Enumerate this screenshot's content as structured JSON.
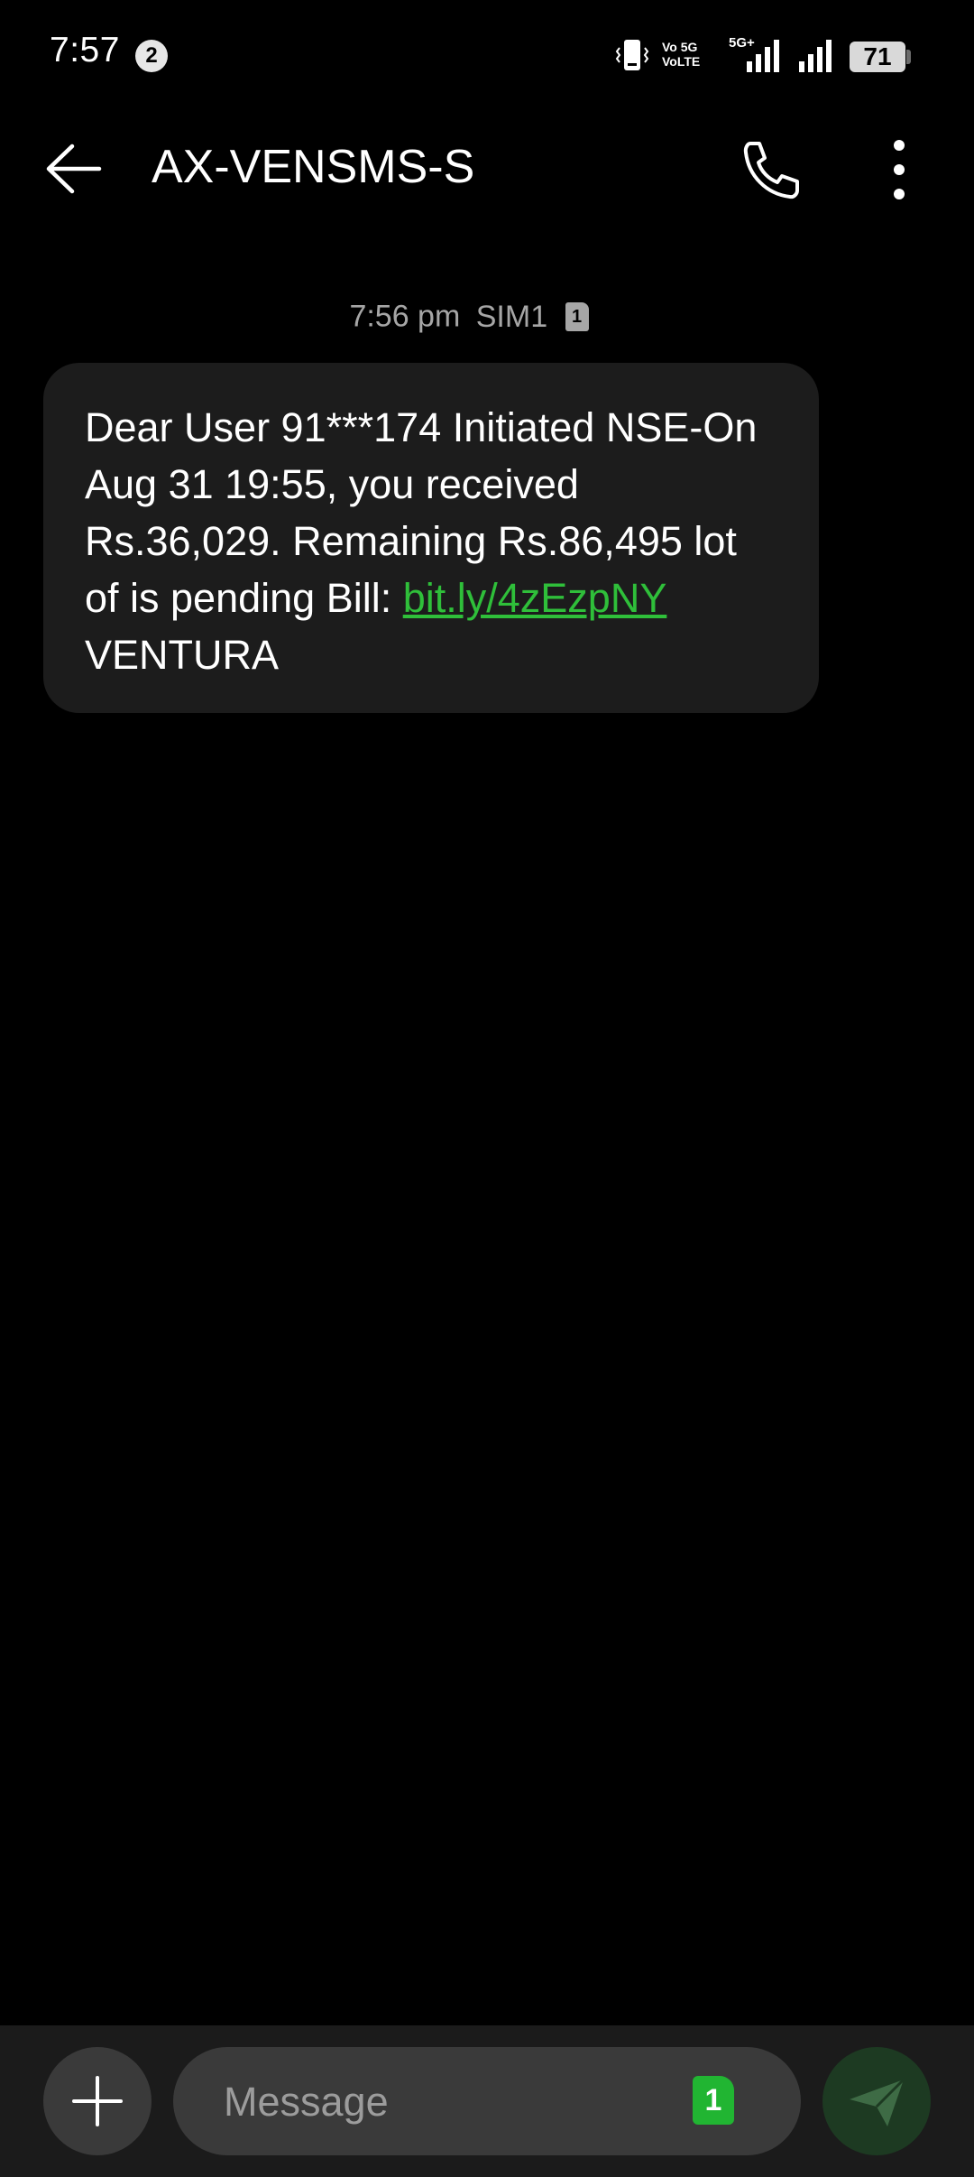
{
  "status_bar": {
    "time": "7:57",
    "notification_count": "2",
    "network_labels": [
      "Vo",
      "5G",
      "VoLTE",
      "5G+"
    ],
    "battery": "71"
  },
  "header": {
    "title": "AX-VENSMS-S"
  },
  "conversation": {
    "timestamp": "7:56 pm",
    "sim_label": "SIM1",
    "sim_number": "1",
    "messages": [
      {
        "text": "Dear User 91***174 Initiated NSE-On Aug 31 19:55, you received Rs.36,029. Remaining Rs.86,495 lot of is pending Bill: ",
        "link": "bit.ly/4zEzpNY",
        "signature": "VENTURA"
      }
    ]
  },
  "composer": {
    "placeholder": "Message",
    "sim_number": "1"
  },
  "colors": {
    "background": "#000000",
    "bubble": "#1c1c1c",
    "link": "#2fbf3a",
    "sim_badge": "#21b532",
    "send_button": "#1d3a22"
  }
}
